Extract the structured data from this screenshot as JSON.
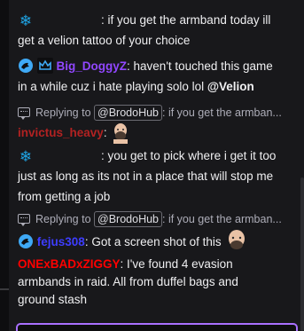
{
  "messages": [
    {
      "id": "m1",
      "badge_icon": "snowflake-icon",
      "text_line1": ": if you get the armband today ill",
      "text_line2": "get a velion tattoo of your choice"
    },
    {
      "id": "m2",
      "badge_icons": [
        "bird-badge-icon",
        "crown-badge-icon"
      ],
      "username": "Big_DoggyZ",
      "username_color": "#9147ff",
      "text_line1": ": haven't touched this game",
      "text_line2_prefix": "in a while cuz i hate playing solo lol ",
      "mention": "@Velion"
    },
    {
      "id": "m3",
      "reply_label": "Replying to",
      "reply_mention": "@BrodoHub",
      "reply_preview": ": if you get the armban...",
      "username": "invictus_heavy",
      "username_color": "#b22222",
      "text": ":",
      "emote": "bald-man-emote"
    },
    {
      "id": "m4",
      "badge_icon": "snowflake-icon",
      "text_line1": ": you get to pick where i get it too",
      "text_line2": "just as long as its not in a place that will stop me",
      "text_line3": "from getting a job"
    },
    {
      "id": "m5",
      "reply_label": "Replying to",
      "reply_mention": "@BrodoHub",
      "reply_preview": ": if you get the armban...",
      "username": "fejus308",
      "username_color": "#3d3dff",
      "text": ": Got a screen shot of this",
      "emote": "bald-man-emote"
    },
    {
      "id": "m6",
      "username": "ONExBADxZIGGY",
      "username_color": "#ff0000",
      "text_line1": ": I've found 4 evasion",
      "text_line2": "armbands in raid. All from duffel bags and",
      "text_line3": "ground stash"
    }
  ],
  "colors": {
    "background": "#18181b",
    "text": "#efeff1",
    "muted": "#adadb8",
    "accent": "#a970ff",
    "snowflake": "#1fa5e6"
  }
}
